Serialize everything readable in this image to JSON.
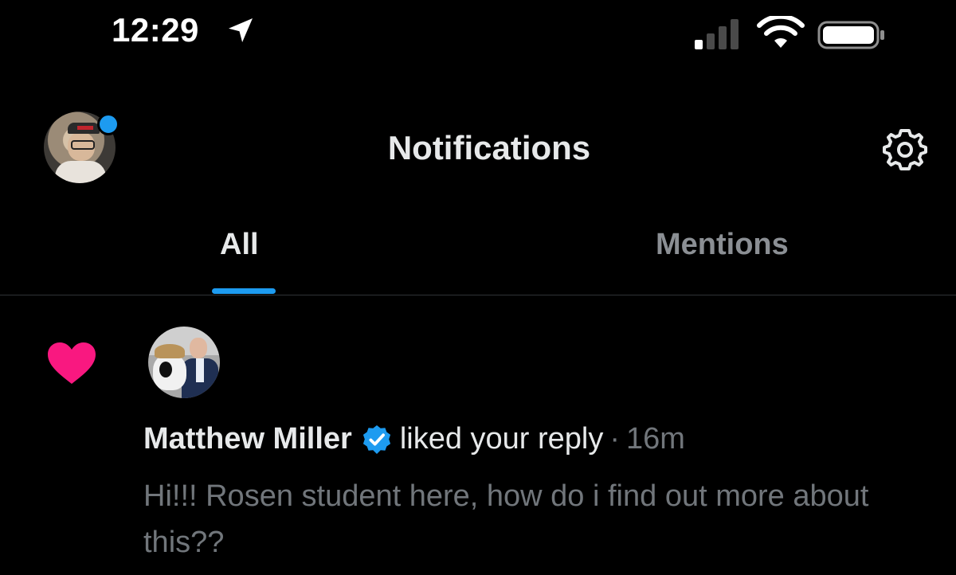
{
  "status_bar": {
    "time": "12:29",
    "icons": [
      "location-arrow-icon",
      "cellular-signal-icon",
      "wifi-icon",
      "battery-icon"
    ]
  },
  "header": {
    "title": "Notifications",
    "settings_icon": "gear-icon",
    "avatar_has_unread_dot": true
  },
  "tabs": [
    {
      "label": "All",
      "selected": true
    },
    {
      "label": "Mentions",
      "selected": false
    }
  ],
  "notification": {
    "type_icon": "heart-icon",
    "user_name": "Matthew Miller",
    "verified_icon": "verified-badge-icon",
    "action": "liked your reply",
    "separator": "·",
    "time": "16m",
    "body": "Hi!!! Rosen student here, how do i find out more about this??"
  },
  "colors": {
    "accent": "#1d9bf0",
    "like": "#f91880",
    "muted_text": "#71767b",
    "background": "#000000"
  }
}
